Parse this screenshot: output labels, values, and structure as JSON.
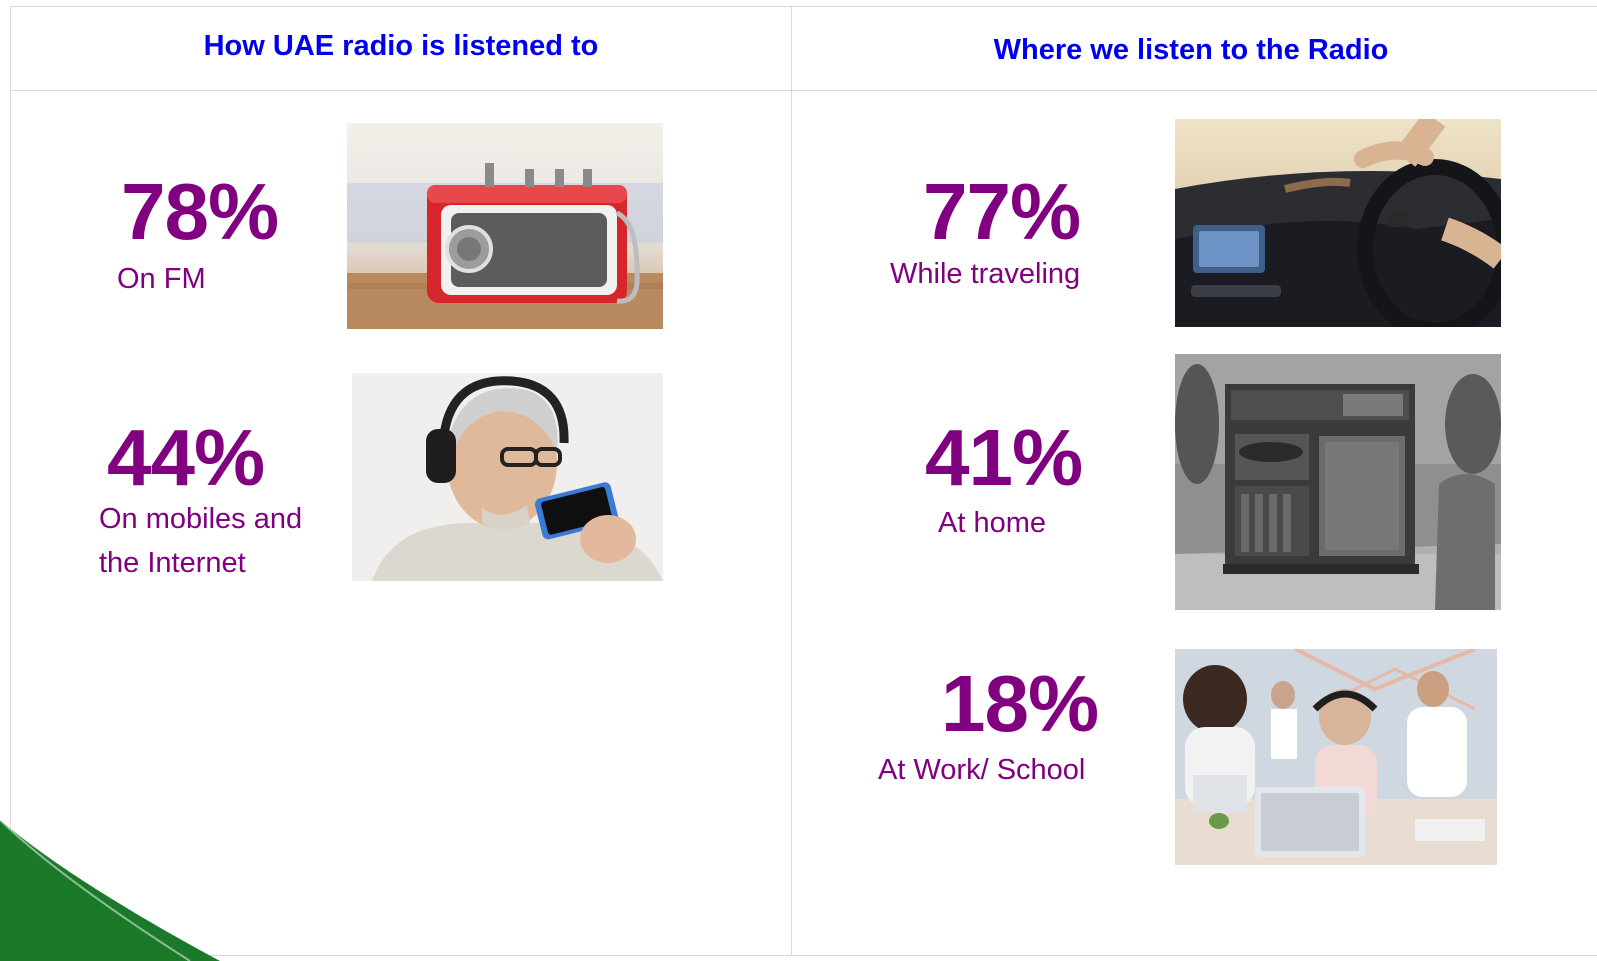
{
  "left_panel": {
    "heading": "How UAE radio is listened to",
    "items": [
      {
        "percent": "78%",
        "label": "On FM",
        "image_icon": "red-portable-radio-photo"
      },
      {
        "percent": "44%",
        "label_lines": [
          "On mobiles and",
          "the Internet"
        ],
        "image_icon": "man-headphones-phone-photo"
      }
    ]
  },
  "right_panel": {
    "heading": "Where we listen to the Radio",
    "items": [
      {
        "percent": "77%",
        "label": "While traveling",
        "image_icon": "car-dashboard-driving-photo"
      },
      {
        "percent": "41%",
        "label": "At home",
        "image_icon": "vintage-radio-cabinet-photo"
      },
      {
        "percent": "18%",
        "label": "At Work/ School",
        "image_icon": "office-people-laptops-photo"
      }
    ]
  },
  "colors": {
    "heading": "#0000ee",
    "stat": "#800080",
    "swoosh": "#1a7a2a"
  }
}
